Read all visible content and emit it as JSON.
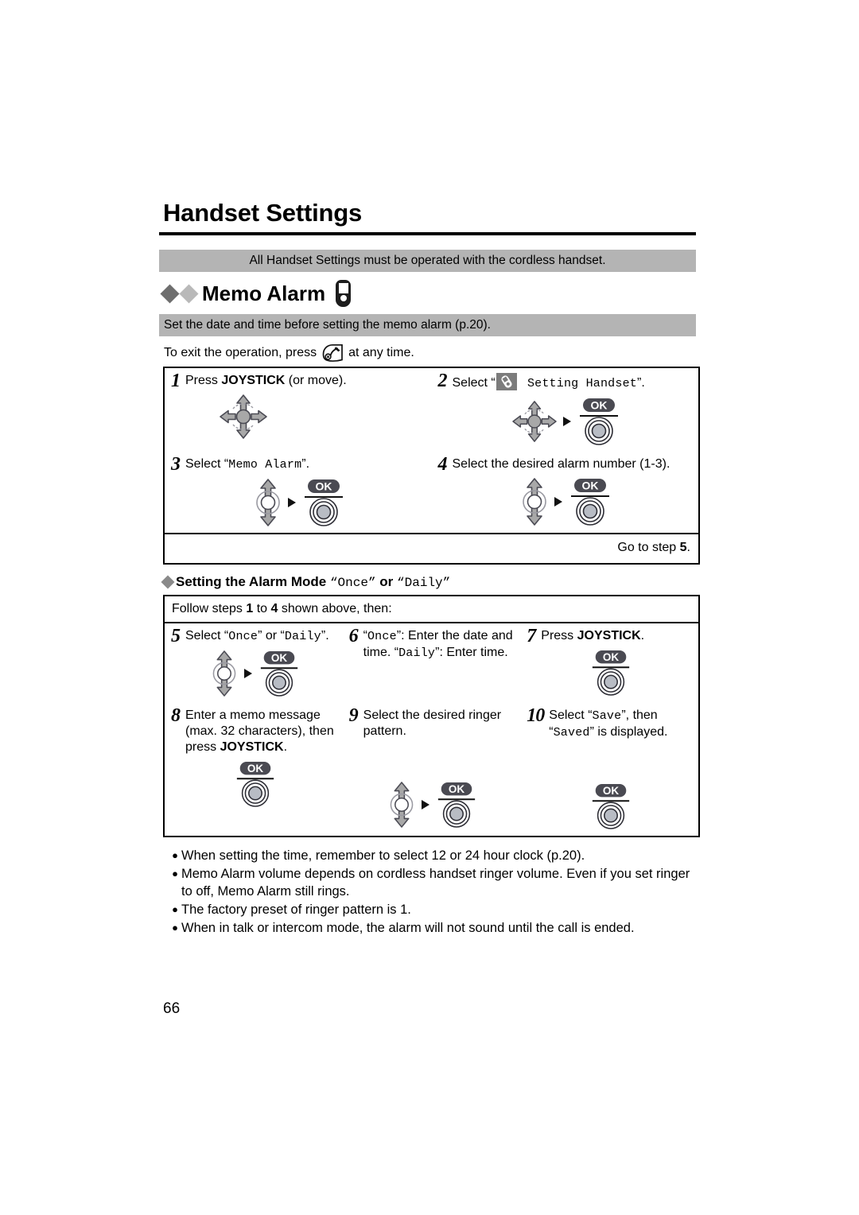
{
  "document": {
    "title": "Handset Settings",
    "page_number": "66",
    "banner_top": "All Handset Settings must be operated with the cordless handset.",
    "section_title": "Memo Alarm",
    "section_icon": "cordless-handset-icon",
    "banner_sub": "Set the date and time before setting the memo alarm (p.20).",
    "exit_prefix": "To exit the operation, press",
    "exit_icon": "off-hook-button-icon",
    "exit_suffix": "at any time."
  },
  "steps_primary": [
    {
      "number": "1",
      "text_parts": [
        {
          "t": "Press ",
          "style": "normal"
        },
        {
          "t": "JOYSTICK",
          "style": "bold"
        },
        {
          "t": " (or move).",
          "style": "normal"
        }
      ],
      "glyphs": [
        "joystick-4way"
      ]
    },
    {
      "number": "2",
      "text_parts": [
        {
          "t": "Select “",
          "style": "normal"
        },
        {
          "t": "",
          "style": "menu-icon"
        },
        {
          "t": " Setting Handset",
          "style": "mono"
        },
        {
          "t": "”.",
          "style": "normal"
        }
      ],
      "glyphs": [
        "joystick-4way",
        "arrow-right",
        "ok-button"
      ]
    },
    {
      "number": "3",
      "text_parts": [
        {
          "t": "Select “",
          "style": "normal"
        },
        {
          "t": "Memo Alarm",
          "style": "mono"
        },
        {
          "t": "”.",
          "style": "normal"
        }
      ],
      "glyphs": [
        "joystick-updown",
        "arrow-right",
        "ok-button"
      ]
    },
    {
      "number": "4",
      "text_parts": [
        {
          "t": "Select the desired alarm number (1-3).",
          "style": "normal"
        }
      ],
      "glyphs": [
        "joystick-updown",
        "arrow-right",
        "ok-button"
      ]
    }
  ],
  "goto_step": {
    "prefix": "Go to step ",
    "number": "5",
    "suffix": "."
  },
  "subsection": {
    "heading_parts": [
      {
        "t": "Setting the Alarm Mode ",
        "style": "bold"
      },
      {
        "t": "“",
        "style": "bold"
      },
      {
        "t": "Once",
        "style": "mono"
      },
      {
        "t": "”",
        "style": "bold"
      },
      {
        "t": " or ",
        "style": "bold"
      },
      {
        "t": "“",
        "style": "bold"
      },
      {
        "t": "Daily",
        "style": "mono"
      },
      {
        "t": "”",
        "style": "bold"
      }
    ],
    "follow_line_parts": [
      {
        "t": "Follow steps ",
        "style": "normal"
      },
      {
        "t": "1",
        "style": "bold"
      },
      {
        "t": " to ",
        "style": "normal"
      },
      {
        "t": "4",
        "style": "bold"
      },
      {
        "t": " shown above, then:",
        "style": "normal"
      }
    ]
  },
  "steps_secondary": [
    {
      "number": "5",
      "text_parts": [
        {
          "t": "Select “",
          "style": "normal"
        },
        {
          "t": "Once",
          "style": "mono"
        },
        {
          "t": "” or “",
          "style": "normal"
        },
        {
          "t": "Daily",
          "style": "mono"
        },
        {
          "t": "”.",
          "style": "normal"
        }
      ],
      "glyphs": [
        "joystick-updown",
        "arrow-right",
        "ok-button"
      ]
    },
    {
      "number": "6",
      "text_parts": [
        {
          "t": "“",
          "style": "normal"
        },
        {
          "t": "Once",
          "style": "mono"
        },
        {
          "t": "”: Enter the date and time. “",
          "style": "normal"
        },
        {
          "t": "Daily",
          "style": "mono"
        },
        {
          "t": "”: Enter time.",
          "style": "normal"
        }
      ],
      "glyphs": []
    },
    {
      "number": "7",
      "text_parts": [
        {
          "t": "Press ",
          "style": "normal"
        },
        {
          "t": "JOYSTICK",
          "style": "bold"
        },
        {
          "t": ".",
          "style": "normal"
        }
      ],
      "glyphs": [
        "ok-button"
      ]
    },
    {
      "number": "8",
      "text_parts": [
        {
          "t": "Enter a memo message (max. 32 characters), then press ",
          "style": "normal"
        },
        {
          "t": "JOYSTICK",
          "style": "bold"
        },
        {
          "t": ".",
          "style": "normal"
        }
      ],
      "glyphs": [
        "ok-button"
      ]
    },
    {
      "number": "9",
      "text_parts": [
        {
          "t": "Select the desired ringer pattern.",
          "style": "normal"
        }
      ],
      "glyphs": [
        "joystick-updown",
        "arrow-right",
        "ok-button"
      ]
    },
    {
      "number": "10",
      "text_parts": [
        {
          "t": "Select “",
          "style": "normal"
        },
        {
          "t": "Save",
          "style": "mono"
        },
        {
          "t": "”, then “",
          "style": "normal"
        },
        {
          "t": "Saved",
          "style": "mono"
        },
        {
          "t": "” is displayed.",
          "style": "normal"
        }
      ],
      "glyphs": [
        "ok-button"
      ]
    }
  ],
  "notes": [
    "When setting the time, remember to select 12 or 24 hour clock (p.20).",
    "Memo Alarm volume depends on cordless handset ringer volume. Even if you set ringer to off, Memo Alarm still rings.",
    "The factory preset of ringer pattern is 1.",
    "When in talk or intercom mode, the alarm will not sound until the call is ended."
  ],
  "ok_button_label": "OK",
  "colors": {
    "banner_gray": "#b4b4b4",
    "glyph_gray": "#a8a8a8",
    "glyph_outline": "#4a4a53",
    "ok_pill": "#4a4a52",
    "diamond_dark": "#6e6e6e",
    "diamond_light": "#b9b9b9"
  }
}
